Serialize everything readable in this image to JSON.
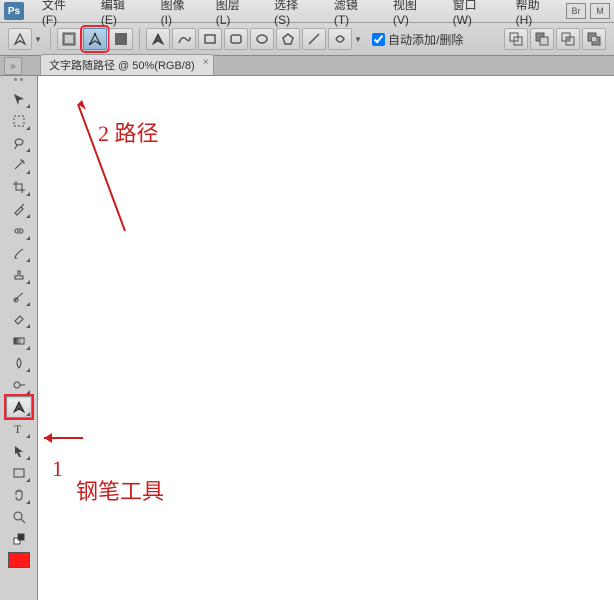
{
  "app": {
    "logo_text": "Ps"
  },
  "menu": {
    "file": "文件(F)",
    "edit": "编辑(E)",
    "image": "图像(I)",
    "layer": "图层(L)",
    "select": "选择(S)",
    "filter": "滤镜(T)",
    "view": "视图(V)",
    "window": "窗口(W)",
    "help": "帮助(H)"
  },
  "options": {
    "auto_add_delete_label": "自动添加/删除"
  },
  "tabs": {
    "doc1": "文字路随路径 @ 50%(RGB/8)"
  },
  "annotations": {
    "label2": "2 路径",
    "num1": "1",
    "label1": "钢笔工具"
  },
  "colors": {
    "foreground": "#ff1a1a"
  },
  "top_right": {
    "br": "Br",
    "mb": "M"
  }
}
